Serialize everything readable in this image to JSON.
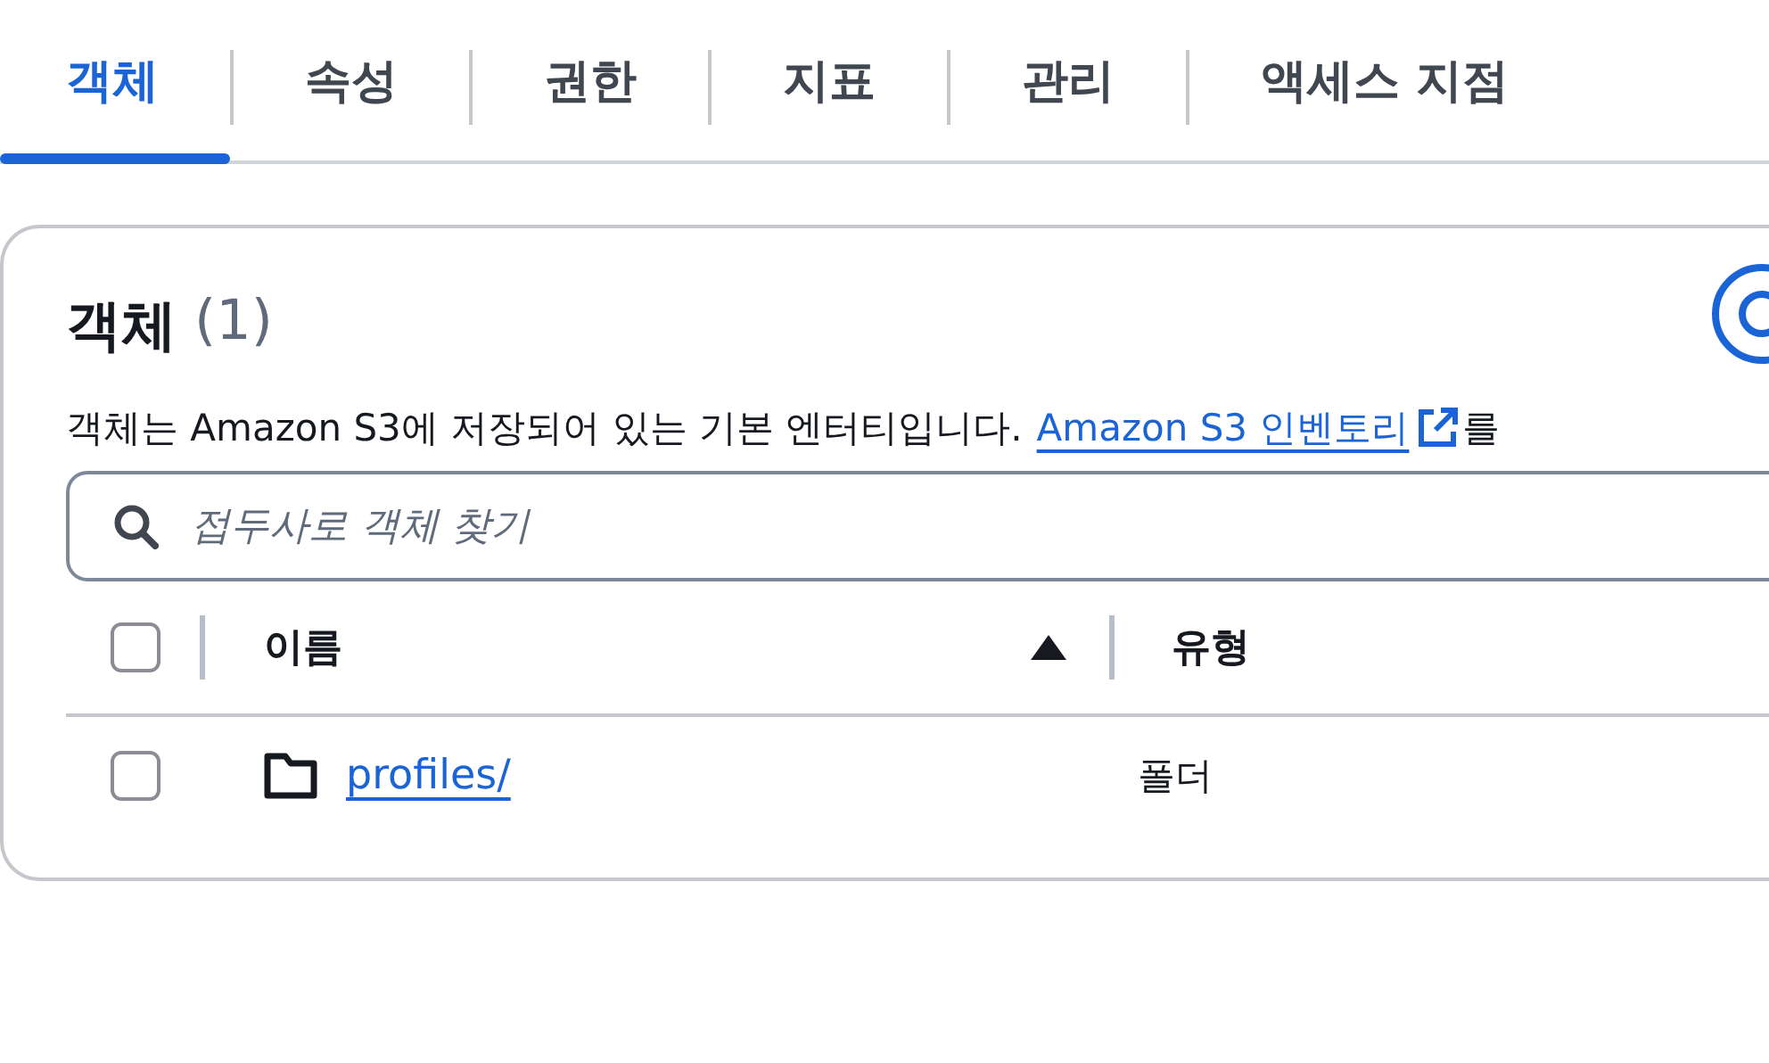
{
  "tabs": [
    {
      "label": "객체",
      "selected": true
    },
    {
      "label": "속성",
      "selected": false
    },
    {
      "label": "권한",
      "selected": false
    },
    {
      "label": "지표",
      "selected": false
    },
    {
      "label": "관리",
      "selected": false
    },
    {
      "label": "액세스 지점",
      "selected": false
    }
  ],
  "panel": {
    "title": "객체",
    "count": "(1)",
    "description": "객체는 Amazon S3에 저장되어 있는 기본 엔터티입니다.",
    "link": "Amazon S3 인벤토리",
    "description_tail": "를",
    "search": {
      "placeholder": "접두사로 객체 찾기"
    },
    "table": {
      "select_all_checked": false,
      "columns": [
        {
          "label": "이름",
          "sort_ascending": true
        },
        {
          "label": "유형"
        }
      ],
      "rows": [
        {
          "name": "profiles/",
          "type": "폴더",
          "selected": false
        }
      ]
    }
  }
}
